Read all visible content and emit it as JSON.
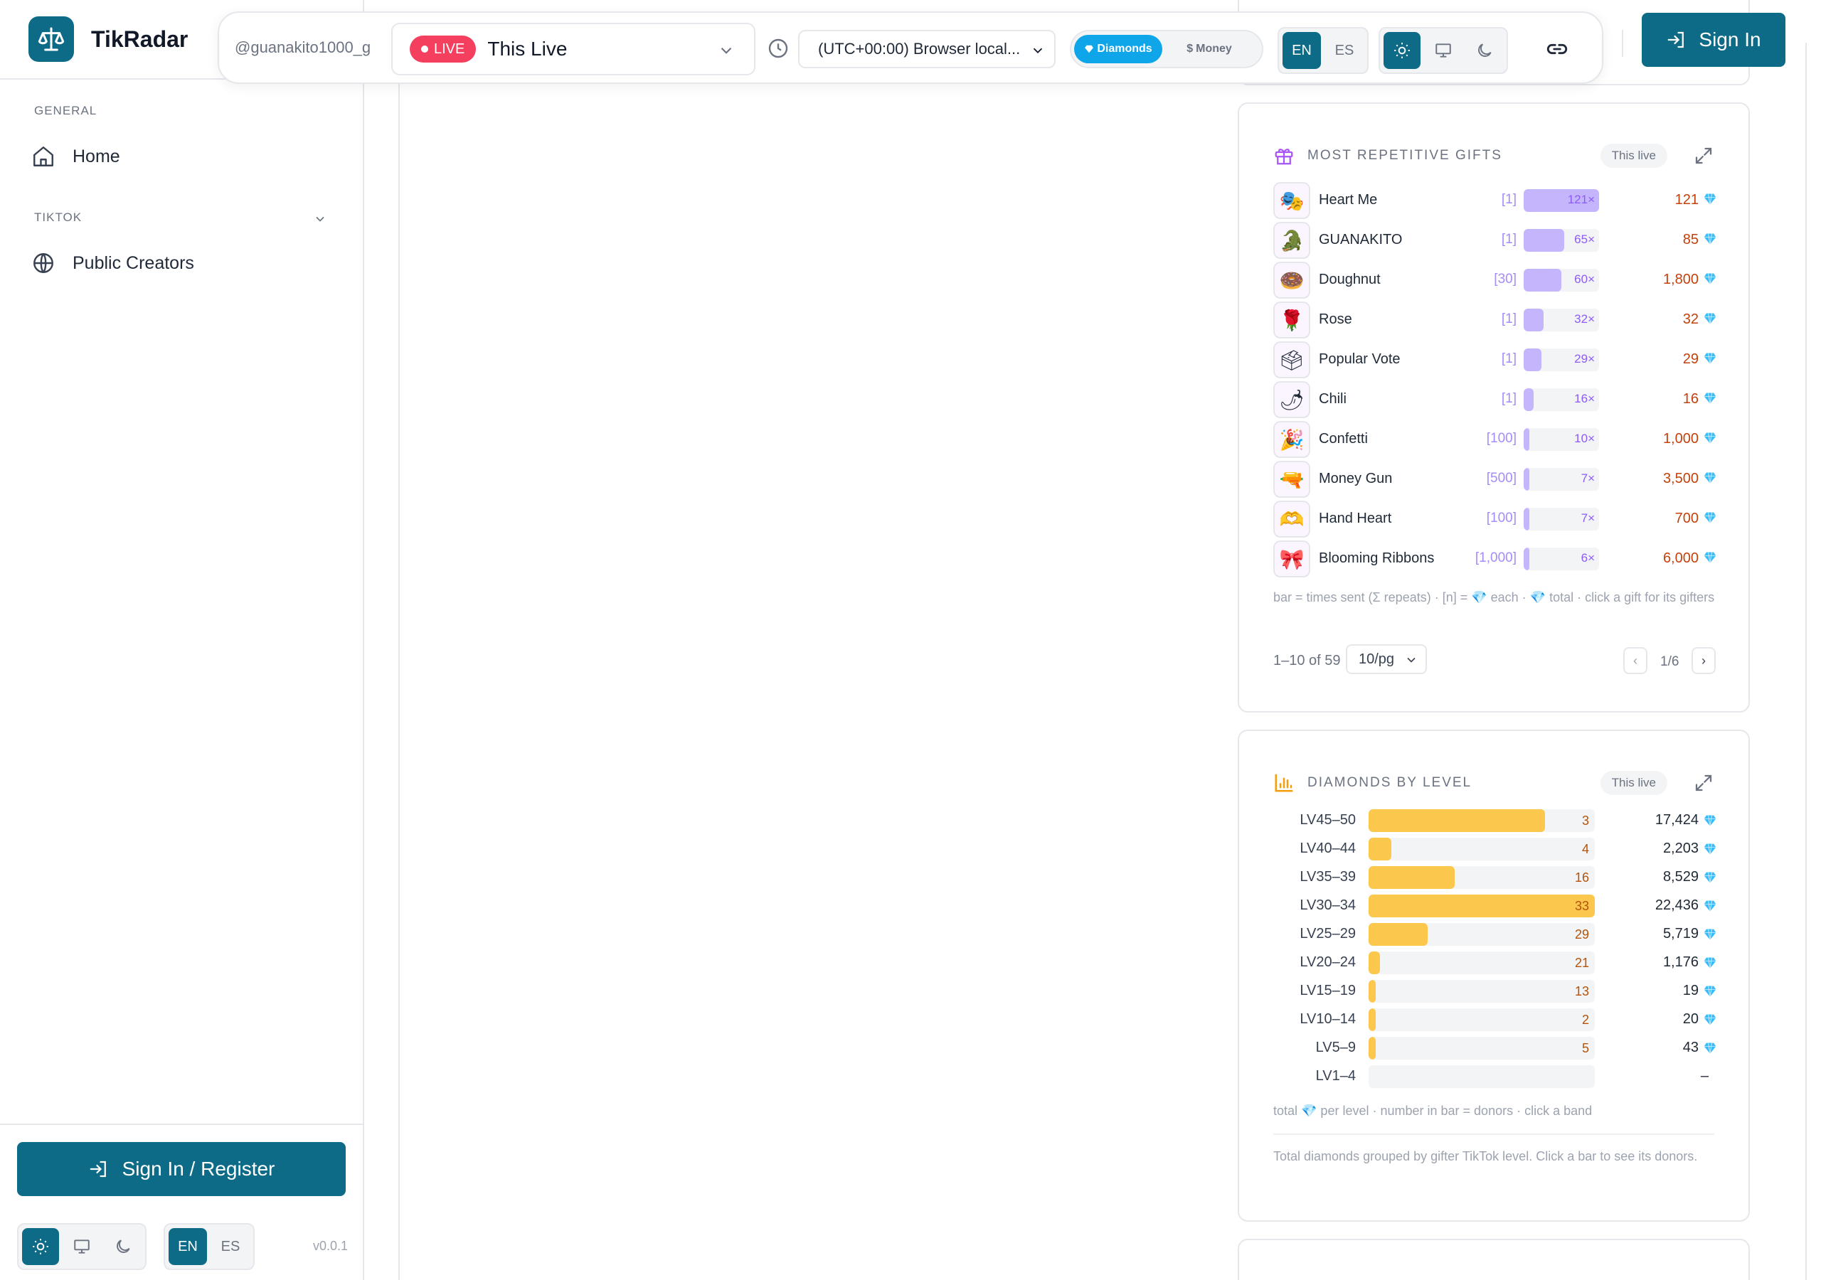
{
  "brand": {
    "name": "TikRadar"
  },
  "sidebar": {
    "sections": [
      {
        "title": "GENERAL",
        "items": [
          {
            "label": "Home",
            "icon": "home-icon"
          }
        ]
      },
      {
        "title": "TIKTOK",
        "items": [
          {
            "label": "Public Creators",
            "icon": "globe-icon"
          }
        ]
      }
    ],
    "signin_label": "Sign In / Register",
    "lang": [
      "EN",
      "ES"
    ],
    "version": "v0.0.1"
  },
  "topbar": {
    "username": "@guanakito1000_g",
    "live_badge": "LIVE",
    "live_title": "This Live",
    "timezone": "(UTC+00:00) Browser local...",
    "currency": {
      "diamonds": "Diamonds",
      "money": "Money",
      "active": "diamonds"
    },
    "lang": [
      "EN",
      "ES"
    ],
    "signin_label": "Sign In"
  },
  "gifts_card": {
    "title": "MOST REPETITIVE GIFTS",
    "badge": "This live",
    "rows": [
      {
        "name": "Heart Me",
        "each": "[1]",
        "times": "121×",
        "pct": 1.0,
        "total": "121",
        "icon": "heart-me-gift-icon",
        "glyph": "🎭"
      },
      {
        "name": "GUANAKITO",
        "each": "[1]",
        "times": "65×",
        "pct": 0.54,
        "total": "85",
        "icon": "guanakito-gift-icon",
        "glyph": "🐊"
      },
      {
        "name": "Doughnut",
        "each": "[30]",
        "times": "60×",
        "pct": 0.5,
        "total": "1,800",
        "icon": "doughnut-gift-icon",
        "glyph": "🍩"
      },
      {
        "name": "Rose",
        "each": "[1]",
        "times": "32×",
        "pct": 0.26,
        "total": "32",
        "icon": "rose-gift-icon",
        "glyph": "🌹"
      },
      {
        "name": "Popular Vote",
        "each": "[1]",
        "times": "29×",
        "pct": 0.24,
        "total": "29",
        "icon": "popular-vote-gift-icon",
        "glyph": "🗳"
      },
      {
        "name": "Chili",
        "each": "[1]",
        "times": "16×",
        "pct": 0.13,
        "total": "16",
        "icon": "chili-gift-icon",
        "glyph": "🌶"
      },
      {
        "name": "Confetti",
        "each": "[100]",
        "times": "10×",
        "pct": 0.08,
        "total": "1,000",
        "icon": "confetti-gift-icon",
        "glyph": "🎉"
      },
      {
        "name": "Money Gun",
        "each": "[500]",
        "times": "7×",
        "pct": 0.06,
        "total": "3,500",
        "icon": "money-gun-gift-icon",
        "glyph": "🔫"
      },
      {
        "name": "Hand Heart",
        "each": "[100]",
        "times": "7×",
        "pct": 0.06,
        "total": "700",
        "icon": "hand-heart-gift-icon",
        "glyph": "🫶"
      },
      {
        "name": "Blooming Ribbons",
        "each": "[1,000]",
        "times": "6×",
        "pct": 0.05,
        "total": "6,000",
        "icon": "blooming-ribbons-gift-icon",
        "glyph": "🎀"
      }
    ],
    "note": "bar = times sent (Σ repeats) · [n] = 💎 each · 💎 total · click a gift for its gifters",
    "pager": {
      "count": "1–10 of 59",
      "per_page": "10/pg",
      "page": "1/6",
      "prev": "‹",
      "next": "›"
    }
  },
  "levels_card": {
    "title": "DIAMONDS BY LEVEL",
    "badge": "This live",
    "rows": [
      {
        "label": "LV45–50",
        "donors": "3",
        "pct": 0.78,
        "total": "17,424"
      },
      {
        "label": "LV40–44",
        "donors": "4",
        "pct": 0.1,
        "total": "2,203"
      },
      {
        "label": "LV35–39",
        "donors": "16",
        "pct": 0.38,
        "total": "8,529"
      },
      {
        "label": "LV30–34",
        "donors": "33",
        "pct": 1.0,
        "total": "22,436"
      },
      {
        "label": "LV25–29",
        "donors": "29",
        "pct": 0.26,
        "total": "5,719"
      },
      {
        "label": "LV20–24",
        "donors": "21",
        "pct": 0.05,
        "total": "1,176"
      },
      {
        "label": "LV15–19",
        "donors": "13",
        "pct": 0.02,
        "total": "19"
      },
      {
        "label": "LV10–14",
        "donors": "2",
        "pct": 0.02,
        "total": "20"
      },
      {
        "label": "LV5–9",
        "donors": "5",
        "pct": 0.02,
        "total": "43"
      },
      {
        "label": "LV1–4",
        "donors": "",
        "pct": 0,
        "total": "–"
      }
    ],
    "note": "total 💎 per level · number in bar = donors · click a band",
    "description": "Total diamonds grouped by gifter TikTok level. Click a bar to see its donors."
  },
  "colors": {
    "accent": "#0e6b87",
    "live": "#f43f5e",
    "gift_bar": "#c4b5fd",
    "level_bar": "#fbc84d",
    "diamond": "#38bdf8"
  }
}
